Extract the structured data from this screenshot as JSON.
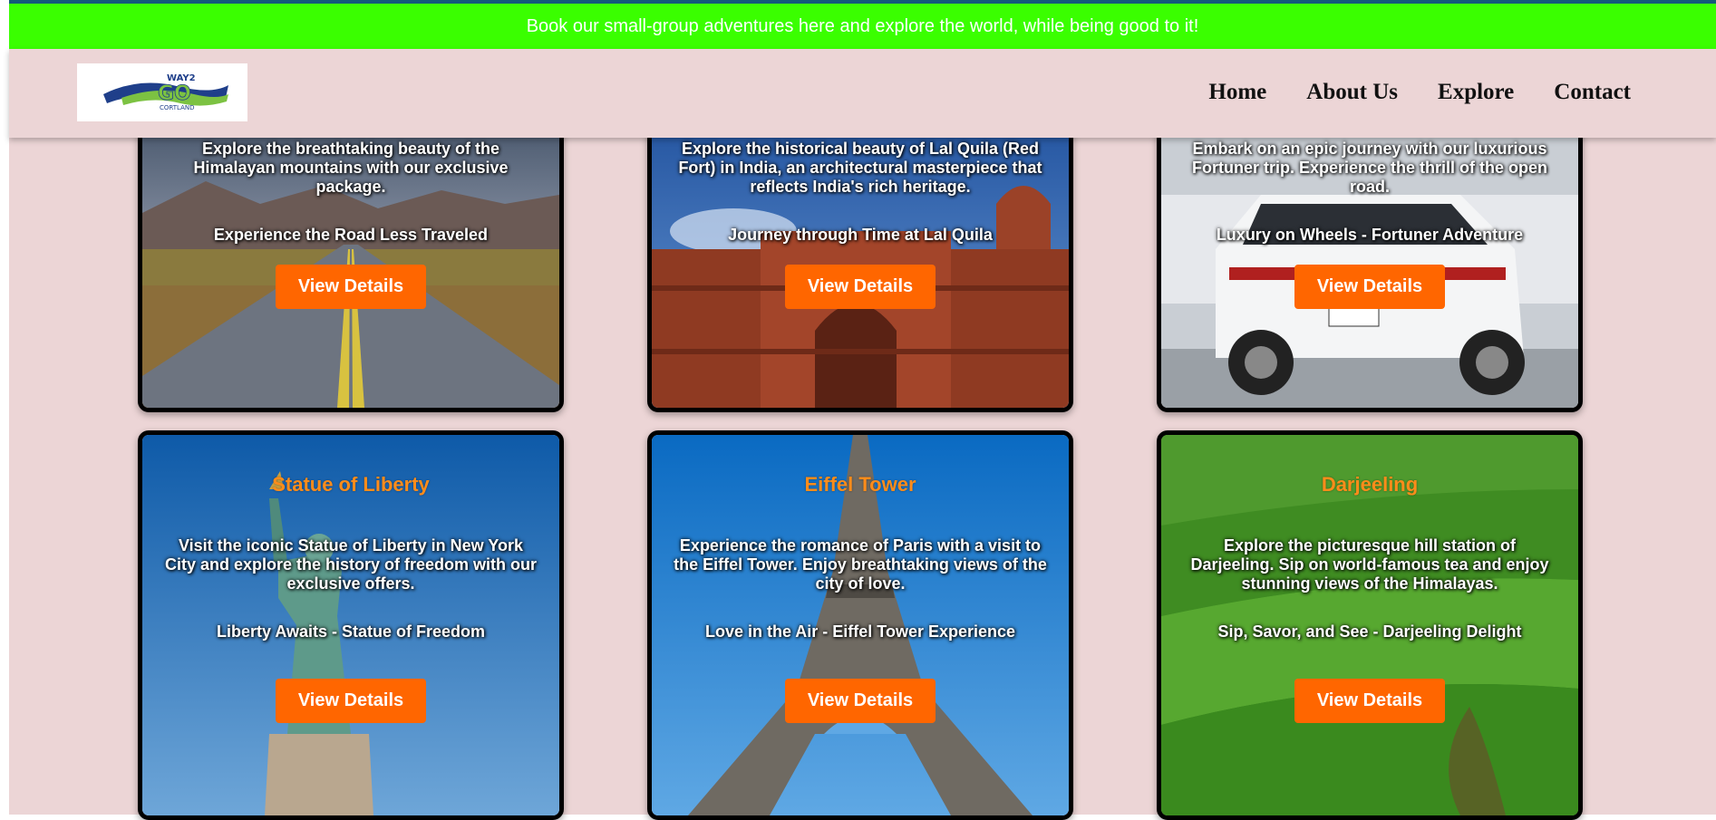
{
  "announcement": "Book our small-group adventures here and explore the world, while being good to it!",
  "logo": {
    "line1": "WAY2",
    "line2": "GO",
    "line3": "CORTLAND"
  },
  "nav": [
    {
      "label": "Home"
    },
    {
      "label": "About Us"
    },
    {
      "label": "Explore"
    },
    {
      "label": "Contact"
    }
  ],
  "cards": [
    {
      "desc": "Explore the breathtaking beauty of the Himalayan mountains with our exclusive package.",
      "tagline": "Experience the Road Less Traveled",
      "button": "View Details"
    },
    {
      "desc": "Explore the historical beauty of Lal Quila (Red Fort) in India, an architectural masterpiece that reflects India's rich heritage.",
      "tagline": "Journey through Time at Lal Quila",
      "button": "View Details"
    },
    {
      "desc": "Embark on an epic journey with our luxurious Fortuner trip. Experience the thrill of the open road.",
      "tagline": "Luxury on Wheels - Fortuner Adventure",
      "button": "View Details"
    },
    {
      "title": "Statue of Liberty",
      "desc": "Visit the iconic Statue of Liberty in New York City and explore the history of freedom with our exclusive offers.",
      "tagline": "Liberty Awaits - Statue of Freedom",
      "button": "View Details"
    },
    {
      "title": "Eiffel Tower",
      "desc": "Experience the romance of Paris with a visit to the Eiffel Tower. Enjoy breathtaking views of the city of love.",
      "tagline": "Love in the Air - Eiffel Tower Experience",
      "button": "View Details"
    },
    {
      "title": "Darjeeling",
      "desc": "Explore the picturesque hill station of Darjeeling. Sip on world-famous tea and enjoy stunning views of the Himalayas.",
      "tagline": "Sip, Savor, and See - Darjeeling Delight",
      "button": "View Details"
    }
  ],
  "colors": {
    "announcement_bg": "#3aff00",
    "page_bg": "#ecd5d6",
    "title": "#ff8c1a",
    "button": "#ff6600"
  }
}
